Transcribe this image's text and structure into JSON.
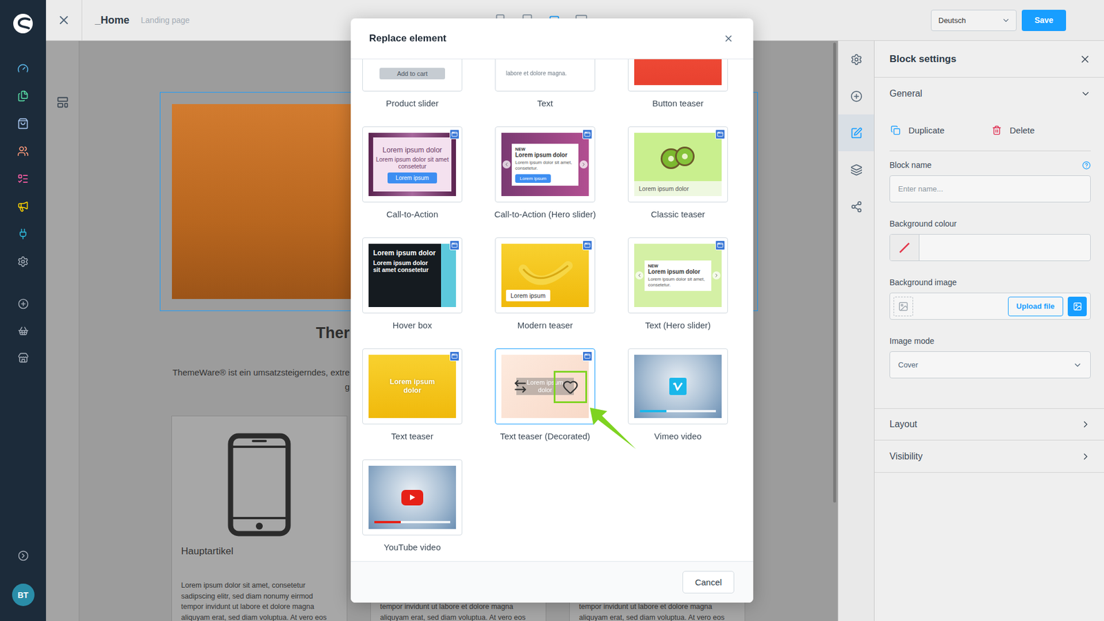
{
  "sidebar": {
    "modules": [
      {
        "color": "#5ab4e5"
      },
      {
        "color": "#57d9a3"
      },
      {
        "color": "#a8c7f0"
      },
      {
        "color": "#ff9a7a"
      },
      {
        "color": "#ff5fa6"
      },
      {
        "color": "#ffd400"
      },
      {
        "color": "#2fb5d6"
      },
      {
        "color": "#a1aab5"
      }
    ],
    "shortcuts": [
      {
        "color": "#a1aab5"
      },
      {
        "color": "#a1aab5"
      },
      {
        "color": "#a1aab5"
      }
    ],
    "avatar": "BT"
  },
  "topbar": {
    "title": "_Home",
    "subtitle": "Landing page",
    "devices": [
      {
        "selected": false
      },
      {
        "selected": false
      },
      {
        "selected": true
      },
      {
        "selected": false
      }
    ],
    "language": "Deutsch",
    "save": "Save"
  },
  "canvas": {
    "heading": "Ther",
    "paragraph": [
      "ThemeWare® ist ein umsatzsteigerndes, extre",
      "g"
    ],
    "cards": [
      {
        "kind": "full",
        "title": "Hauptartikel",
        "lines": [
          "Lorem ipsum dolor sit amet, consetetur",
          "sadipscing elitr, sed diam nonumy eirmod",
          "tempor invidunt ut labore et dolore magna",
          "aliquyam erat, sed diam voluptua. At vero eos"
        ]
      },
      {
        "kind": "covered",
        "lines": [
          "tempor invidunt ut labore et dolore magna",
          "aliquyam erat, sed diam voluptua. At vero eos"
        ]
      },
      {
        "kind": "covered",
        "lines": [
          "tempor invidunt ut labore et dolore magna",
          "aliquyam erat, sed diam voluptua. At vero eos"
        ]
      }
    ]
  },
  "rail": {
    "items": [
      {
        "selected": false
      },
      {
        "selected": false
      },
      {
        "selected": true
      },
      {
        "selected": false
      },
      {
        "selected": false
      }
    ]
  },
  "panel": {
    "title": "Block settings",
    "sections": [
      {
        "label": "General",
        "expanded": true
      },
      {
        "label": "Layout",
        "expanded": false
      },
      {
        "label": "Visibility",
        "expanded": false
      }
    ],
    "actions": [
      "Duplicate",
      "Delete"
    ],
    "fields": [
      {
        "label": "Block name",
        "kind": "text",
        "placeholder": "Enter name...",
        "help": true
      },
      {
        "label": "Background colour",
        "kind": "color",
        "help": false
      },
      {
        "label": "Background image",
        "kind": "image",
        "button": "Upload file",
        "help": false
      },
      {
        "label": "Image mode",
        "kind": "select",
        "value": "Cover",
        "help": false
      }
    ]
  },
  "modal": {
    "title": "Replace element",
    "cancel": "Cancel",
    "elements": [
      {
        "label": "Product slider",
        "kind": "product",
        "badge": false,
        "highlighted": false,
        "annotated": false,
        "texts": [
          "Add to cart"
        ]
      },
      {
        "label": "Text",
        "kind": "text",
        "badge": false,
        "highlighted": false,
        "annotated": false,
        "texts": [
          "labore et dolore magna."
        ]
      },
      {
        "label": "Button teaser",
        "kind": "button",
        "badge": false,
        "highlighted": false,
        "annotated": false,
        "texts": []
      },
      {
        "label": "Call-to-Action",
        "kind": "cta",
        "badge": true,
        "highlighted": false,
        "annotated": false,
        "texts": [
          "Lorem ipsum dolor",
          "Lorem ipsum dolor sit amet consetetur",
          "Lorem ipsum"
        ]
      },
      {
        "label": "Call-to-Action (Hero slider)",
        "kind": "ctaHero",
        "badge": true,
        "highlighted": false,
        "annotated": false,
        "texts": [
          "NEW",
          "Lorem ipsum dolor",
          "Lorem ipsum dolor sit amet, consetetur.",
          "Lorem ipsum"
        ]
      },
      {
        "label": "Classic teaser",
        "kind": "classic",
        "badge": true,
        "highlighted": false,
        "annotated": false,
        "texts": [
          "Lorem ipsum dolor"
        ]
      },
      {
        "label": "Hover box",
        "kind": "hover",
        "badge": true,
        "highlighted": false,
        "annotated": false,
        "texts": [
          "Lorem ipsum dolor",
          "Lorem ipsum dolor sit amet consetetur"
        ]
      },
      {
        "label": "Modern teaser",
        "kind": "modern",
        "badge": true,
        "highlighted": false,
        "annotated": false,
        "texts": [
          "Lorem ipsum"
        ]
      },
      {
        "label": "Text (Hero slider)",
        "kind": "textHero",
        "badge": true,
        "highlighted": false,
        "annotated": false,
        "texts": [
          "NEW",
          "Lorem ipsum dolor",
          "Lorem ipsum dolor sit amet, consetetur."
        ]
      },
      {
        "label": "Text teaser",
        "kind": "textTeaser",
        "badge": true,
        "highlighted": false,
        "annotated": false,
        "texts": [
          "Lorem ipsum dolor"
        ]
      },
      {
        "label": "Text teaser (Decorated)",
        "kind": "decorated",
        "badge": true,
        "highlighted": true,
        "annotated": true,
        "texts": [
          "Lorem ipsum dolor"
        ]
      },
      {
        "label": "Vimeo video",
        "kind": "vimeo",
        "badge": false,
        "highlighted": false,
        "annotated": false,
        "texts": []
      },
      {
        "label": "YouTube video",
        "kind": "youtube",
        "badge": false,
        "highlighted": false,
        "annotated": false,
        "texts": []
      }
    ]
  }
}
